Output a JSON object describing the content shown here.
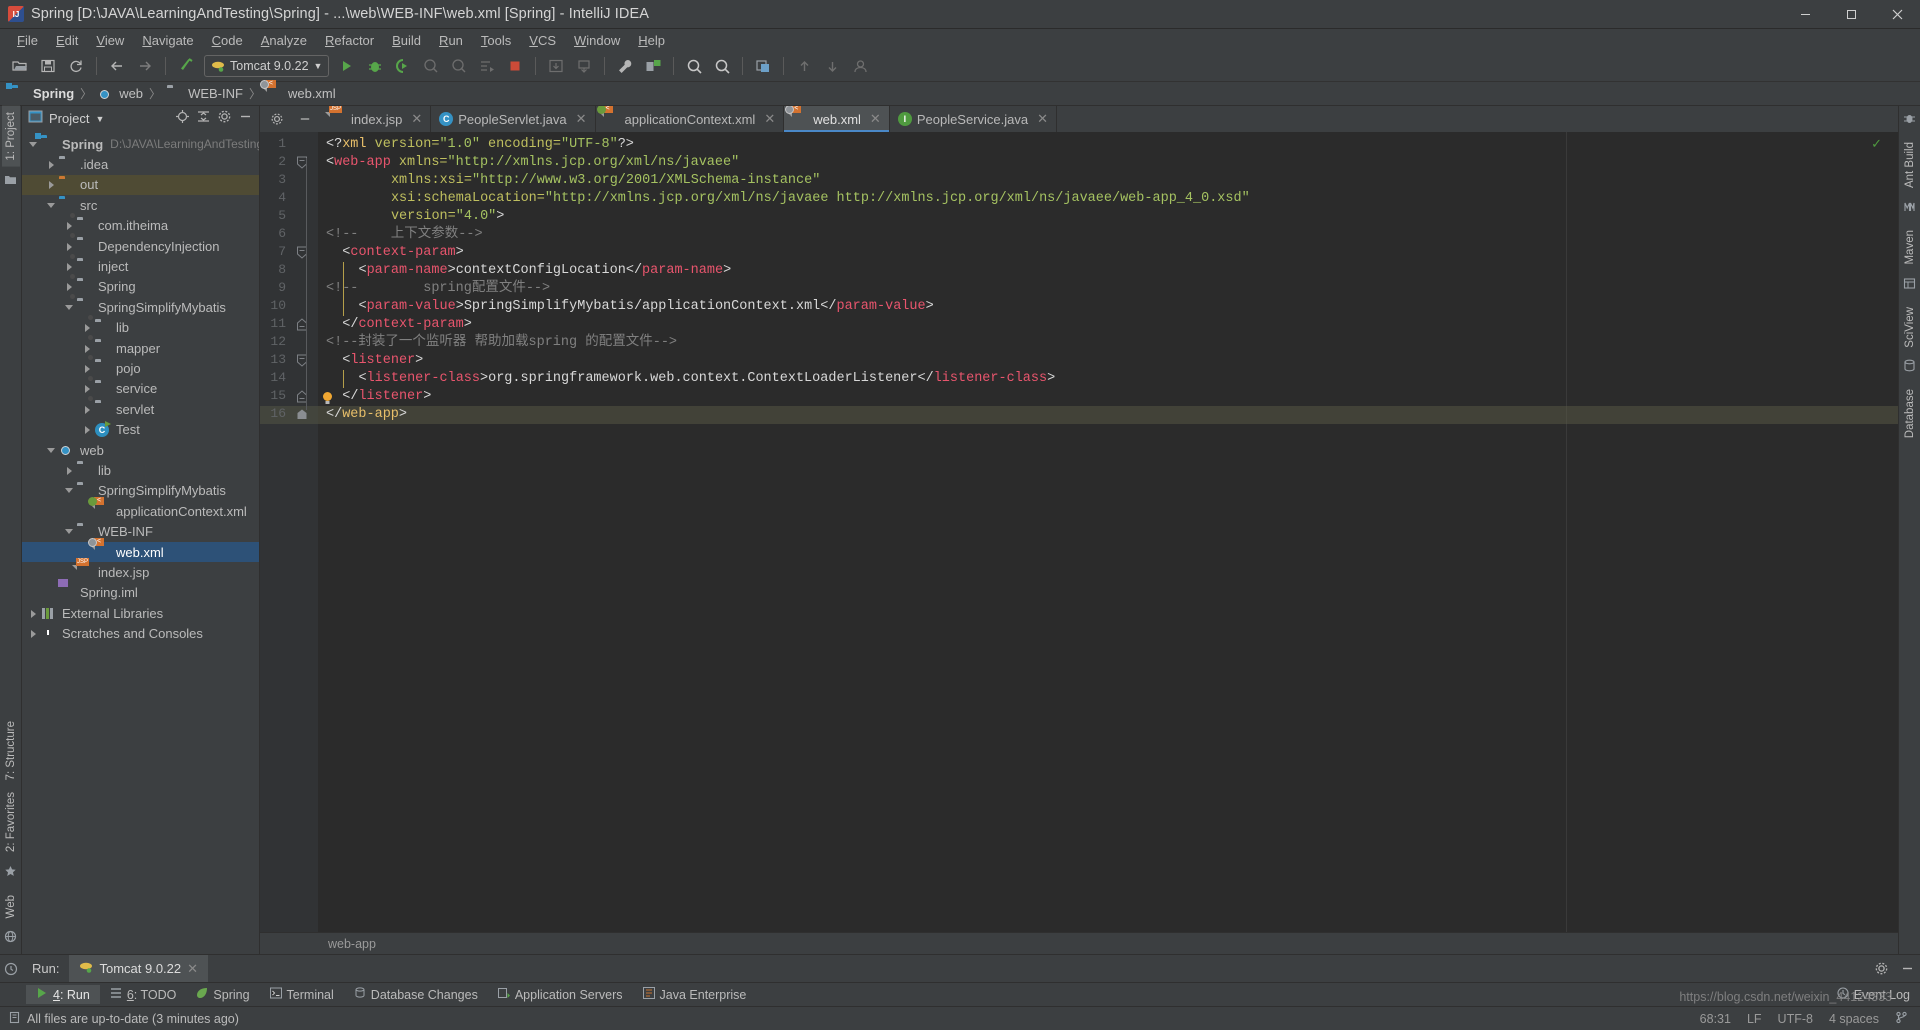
{
  "window": {
    "title": "Spring [D:\\JAVA\\LearningAndTesting\\Spring] - ...\\web\\WEB-INF\\web.xml [Spring] - IntelliJ IDEA",
    "app_icon": "intellij-idea-icon",
    "minimize": "–",
    "maximize": "□",
    "close": "✕"
  },
  "menubar": {
    "items": [
      {
        "label": "File"
      },
      {
        "label": "Edit"
      },
      {
        "label": "View"
      },
      {
        "label": "Navigate"
      },
      {
        "label": "Code"
      },
      {
        "label": "Analyze"
      },
      {
        "label": "Refactor"
      },
      {
        "label": "Build"
      },
      {
        "label": "Run"
      },
      {
        "label": "Tools"
      },
      {
        "label": "VCS"
      },
      {
        "label": "Window"
      },
      {
        "label": "Help"
      }
    ]
  },
  "toolbar": {
    "run_config": "Tomcat 9.0.22",
    "icons": [
      "open-folder-icon",
      "save-all-icon",
      "sync-refresh-icon",
      "back-arrow-icon",
      "forward-arrow-icon",
      "build-hammer-icon",
      "run-icon",
      "debug-icon",
      "run-with-coverage-icon",
      "profile-icon",
      "rerun-icon",
      "update-app-icon",
      "stop-icon",
      "settings-wrench-icon",
      "project-structure-icon",
      "search-everywhere-icon",
      "find-icon",
      "git-commit-icon",
      "git-update-icon",
      "git-push-icon",
      "user-icon"
    ]
  },
  "breadcrumb": {
    "items": [
      {
        "label": "Spring",
        "icon": "module-folder-icon"
      },
      {
        "label": "web",
        "icon": "web-module-icon"
      },
      {
        "label": "WEB-INF",
        "icon": "folder-icon"
      },
      {
        "label": "web.xml",
        "icon": "xml-file-icon"
      }
    ],
    "separator": "〉"
  },
  "left_strip": {
    "project_tab": "1: Project",
    "structure_tab": "7: Structure",
    "favorites_tab": "2: Favorites",
    "web_tab": "Web"
  },
  "right_strip": {
    "ant_build": "Ant Build",
    "maven": "Maven",
    "sciview": "SciView",
    "database": "Database"
  },
  "project_panel": {
    "title": "Project",
    "dropdown_icon": "chevron-down-icon",
    "locate_icon": "target-locate-icon",
    "collapse_icon": "collapse-all-icon",
    "settings_icon": "gear-icon",
    "hide_icon": "hide-icon",
    "tree": [
      {
        "label": "Spring",
        "path": "D:\\JAVA\\LearningAndTesting",
        "depth": 0,
        "state": "open",
        "icon": "module-folder-icon",
        "bold": true,
        "selected": false,
        "highlight": false
      },
      {
        "label": ".idea",
        "path": "",
        "depth": 1,
        "state": "closed",
        "icon": "folder-icon",
        "bold": false,
        "selected": false,
        "highlight": false
      },
      {
        "label": "out",
        "path": "",
        "depth": 1,
        "state": "closed",
        "icon": "folder-orange-icon",
        "bold": false,
        "selected": false,
        "highlight": true
      },
      {
        "label": "src",
        "path": "",
        "depth": 1,
        "state": "open",
        "icon": "source-folder-icon",
        "bold": false,
        "selected": false,
        "highlight": false
      },
      {
        "label": "com.itheima",
        "path": "",
        "depth": 2,
        "state": "closed",
        "icon": "package-icon",
        "bold": false,
        "selected": false,
        "highlight": false
      },
      {
        "label": "DependencyInjection",
        "path": "",
        "depth": 2,
        "state": "closed",
        "icon": "package-icon",
        "bold": false,
        "selected": false,
        "highlight": false
      },
      {
        "label": "inject",
        "path": "",
        "depth": 2,
        "state": "closed",
        "icon": "package-icon",
        "bold": false,
        "selected": false,
        "highlight": false
      },
      {
        "label": "Spring",
        "path": "",
        "depth": 2,
        "state": "closed",
        "icon": "package-icon",
        "bold": false,
        "selected": false,
        "highlight": false
      },
      {
        "label": "SpringSimplifyMybatis",
        "path": "",
        "depth": 2,
        "state": "open",
        "icon": "package-icon",
        "bold": false,
        "selected": false,
        "highlight": false
      },
      {
        "label": "lib",
        "path": "",
        "depth": 3,
        "state": "closed",
        "icon": "package-icon",
        "bold": false,
        "selected": false,
        "highlight": false
      },
      {
        "label": "mapper",
        "path": "",
        "depth": 3,
        "state": "closed",
        "icon": "package-icon",
        "bold": false,
        "selected": false,
        "highlight": false
      },
      {
        "label": "pojo",
        "path": "",
        "depth": 3,
        "state": "closed",
        "icon": "package-icon",
        "bold": false,
        "selected": false,
        "highlight": false
      },
      {
        "label": "service",
        "path": "",
        "depth": 3,
        "state": "closed",
        "icon": "package-icon",
        "bold": false,
        "selected": false,
        "highlight": false
      },
      {
        "label": "servlet",
        "path": "",
        "depth": 3,
        "state": "closed",
        "icon": "package-icon",
        "bold": false,
        "selected": false,
        "highlight": false
      },
      {
        "label": "Test",
        "path": "",
        "depth": 3,
        "state": "closed",
        "icon": "java-test-class-icon",
        "bold": false,
        "selected": false,
        "highlight": false
      },
      {
        "label": "web",
        "path": "",
        "depth": 1,
        "state": "open",
        "icon": "web-module-icon",
        "bold": false,
        "selected": false,
        "highlight": false
      },
      {
        "label": "lib",
        "path": "",
        "depth": 2,
        "state": "closed",
        "icon": "folder-icon",
        "bold": false,
        "selected": false,
        "highlight": false
      },
      {
        "label": "SpringSimplifyMybatis",
        "path": "",
        "depth": 2,
        "state": "open",
        "icon": "folder-icon",
        "bold": false,
        "selected": false,
        "highlight": false
      },
      {
        "label": "applicationContext.xml",
        "path": "",
        "depth": 3,
        "state": "leaf",
        "icon": "spring-xml-file-icon",
        "bold": false,
        "selected": false,
        "highlight": false
      },
      {
        "label": "WEB-INF",
        "path": "",
        "depth": 2,
        "state": "open",
        "icon": "folder-icon",
        "bold": false,
        "selected": false,
        "highlight": false
      },
      {
        "label": "web.xml",
        "path": "",
        "depth": 3,
        "state": "leaf",
        "icon": "xml-file-icon",
        "bold": false,
        "selected": true,
        "highlight": false
      },
      {
        "label": "index.jsp",
        "path": "",
        "depth": 2,
        "state": "leaf",
        "icon": "jsp-file-icon",
        "bold": false,
        "selected": false,
        "highlight": false
      },
      {
        "label": "Spring.iml",
        "path": "",
        "depth": 1,
        "state": "leaf",
        "icon": "iml-file-icon",
        "bold": false,
        "selected": false,
        "highlight": false
      },
      {
        "label": "External Libraries",
        "path": "",
        "depth": 0,
        "state": "closed",
        "icon": "libraries-icon",
        "bold": false,
        "selected": false,
        "highlight": false
      },
      {
        "label": "Scratches and Consoles",
        "path": "",
        "depth": 0,
        "state": "closed",
        "icon": "scratches-icon",
        "bold": false,
        "selected": false,
        "highlight": false
      }
    ]
  },
  "editor": {
    "tabs": [
      {
        "label": "index.jsp",
        "icon": "jsp-file-icon",
        "active": false
      },
      {
        "label": "PeopleServlet.java",
        "icon": "java-class-icon",
        "active": false
      },
      {
        "label": "applicationContext.xml",
        "icon": "spring-xml-file-icon",
        "active": false
      },
      {
        "label": "web.xml",
        "icon": "xml-file-icon",
        "active": true
      },
      {
        "label": "PeopleService.java",
        "icon": "java-interface-icon",
        "active": false
      }
    ],
    "close_icon": "✕",
    "gear_icon": "gear-icon",
    "minimize_icon": "minimize-icon",
    "current_line": 16,
    "inspection_ok_icon": "✓",
    "breadcrumb_footer": "web-app",
    "lines": [
      {
        "n": 1,
        "indent": 0,
        "fold": "",
        "tokens": [
          {
            "t": "<?",
            "c": "k-brk"
          },
          {
            "t": "xml",
            "c": "k-pi"
          },
          {
            "t": " version=",
            "c": "k-attr"
          },
          {
            "t": "\"1.0\"",
            "c": "k-str"
          },
          {
            "t": " encoding=",
            "c": "k-attr"
          },
          {
            "t": "\"UTF-8\"",
            "c": "k-str"
          },
          {
            "t": "?>",
            "c": "k-brk"
          }
        ]
      },
      {
        "n": 2,
        "indent": 0,
        "fold": "open",
        "tokens": [
          {
            "t": "<",
            "c": "k-brk"
          },
          {
            "t": "web-app",
            "c": "k-tag"
          },
          {
            "t": " xmlns=",
            "c": "k-attr"
          },
          {
            "t": "\"http://xmlns.jcp.org/xml/ns/javaee\"",
            "c": "k-str"
          }
        ]
      },
      {
        "n": 3,
        "indent": 8,
        "fold": "",
        "tokens": [
          {
            "t": "xmlns:",
            "c": "k-attr"
          },
          {
            "t": "xsi",
            "c": "k-attr"
          },
          {
            "t": "=",
            "c": "k-attr"
          },
          {
            "t": "\"http://www.w3.org/2001/XMLSchema-instance\"",
            "c": "k-str"
          }
        ]
      },
      {
        "n": 4,
        "indent": 8,
        "fold": "",
        "tokens": [
          {
            "t": "xsi:schemaLocation=",
            "c": "k-attr"
          },
          {
            "t": "\"http://xmlns.jcp.org/xml/ns/javaee http://xmlns.jcp.org/xml/ns/javaee/web-app_4_0.xsd\"",
            "c": "k-str"
          }
        ]
      },
      {
        "n": 5,
        "indent": 8,
        "fold": "",
        "tokens": [
          {
            "t": "version=",
            "c": "k-attr"
          },
          {
            "t": "\"4.0\"",
            "c": "k-str"
          },
          {
            "t": ">",
            "c": "k-brk"
          }
        ]
      },
      {
        "n": 6,
        "indent": -3,
        "fold": "",
        "tokens": [
          {
            "t": "<!--    上下文参数-->",
            "c": "k-cmt"
          }
        ]
      },
      {
        "n": 7,
        "indent": 2,
        "fold": "open",
        "tokens": [
          {
            "t": "<",
            "c": "k-brk"
          },
          {
            "t": "context-param",
            "c": "k-tag"
          },
          {
            "t": ">",
            "c": "k-brk"
          }
        ]
      },
      {
        "n": 8,
        "indent": 4,
        "fold": "",
        "tokens": [
          {
            "t": "<",
            "c": "k-brk"
          },
          {
            "t": "param-name",
            "c": "k-tag"
          },
          {
            "t": ">",
            "c": "k-brk"
          },
          {
            "t": "contextConfigLocation",
            "c": "k-txt"
          },
          {
            "t": "</",
            "c": "k-brk"
          },
          {
            "t": "param-name",
            "c": "k-tag"
          },
          {
            "t": ">",
            "c": "k-brk"
          }
        ]
      },
      {
        "n": 9,
        "indent": -3,
        "fold": "",
        "tokens": [
          {
            "t": "<!--        spring配置文件-->",
            "c": "k-cmt"
          }
        ]
      },
      {
        "n": 10,
        "indent": 4,
        "fold": "",
        "tokens": [
          {
            "t": "<",
            "c": "k-brk"
          },
          {
            "t": "param-value",
            "c": "k-tag"
          },
          {
            "t": ">",
            "c": "k-brk"
          },
          {
            "t": "SpringSimplifyMybatis/applicationContext.xml",
            "c": "k-txt"
          },
          {
            "t": "</",
            "c": "k-brk"
          },
          {
            "t": "param-value",
            "c": "k-tag"
          },
          {
            "t": ">",
            "c": "k-brk"
          }
        ]
      },
      {
        "n": 11,
        "indent": 2,
        "fold": "close",
        "tokens": [
          {
            "t": "</",
            "c": "k-brk"
          },
          {
            "t": "context-param",
            "c": "k-tag"
          },
          {
            "t": ">",
            "c": "k-brk"
          }
        ]
      },
      {
        "n": 12,
        "indent": -3,
        "fold": "",
        "tokens": [
          {
            "t": "<!--封装了一个监听器 帮助加载spring 的配置文件-->",
            "c": "k-cmt"
          }
        ]
      },
      {
        "n": 13,
        "indent": 2,
        "fold": "open",
        "tokens": [
          {
            "t": "<",
            "c": "k-brk"
          },
          {
            "t": "listener",
            "c": "k-tag"
          },
          {
            "t": ">",
            "c": "k-brk"
          }
        ]
      },
      {
        "n": 14,
        "indent": 4,
        "fold": "",
        "tokens": [
          {
            "t": "<",
            "c": "k-brk"
          },
          {
            "t": "listener-class",
            "c": "k-tag"
          },
          {
            "t": ">",
            "c": "k-brk"
          },
          {
            "t": "org.springframework.web.context.ContextLoaderListener",
            "c": "k-txt"
          },
          {
            "t": "</",
            "c": "k-brk"
          },
          {
            "t": "listener-class",
            "c": "k-tag"
          },
          {
            "t": ">",
            "c": "k-brk"
          }
        ]
      },
      {
        "n": 15,
        "indent": 2,
        "fold": "close",
        "tokens": [
          {
            "t": "</",
            "c": "k-brk"
          },
          {
            "t": "listener",
            "c": "k-tag"
          },
          {
            "t": ">",
            "c": "k-brk"
          }
        ]
      },
      {
        "n": 16,
        "indent": 0,
        "fold": "end",
        "tokens": [
          {
            "t": "</",
            "c": "k-brk"
          },
          {
            "t": "web-app",
            "c": "k-web"
          },
          {
            "t": ">",
            "c": "k-brk"
          }
        ]
      }
    ]
  },
  "run_window": {
    "label": "Run:",
    "tab": "Tomcat 9.0.22",
    "tab_icon": "tomcat-icon",
    "close_icon": "✕",
    "settings_icon": "gear-icon",
    "minimize_icon": "–"
  },
  "bottom_bar": {
    "items": [
      {
        "label": "4: Run",
        "icon": "run-icon",
        "selected": true
      },
      {
        "label": "6: TODO",
        "icon": "todo-icon",
        "selected": false
      },
      {
        "label": "Spring",
        "icon": "spring-leaf-icon",
        "selected": false
      },
      {
        "label": "Terminal",
        "icon": "terminal-icon",
        "selected": false
      },
      {
        "label": "Database Changes",
        "icon": "database-changes-icon",
        "selected": false
      },
      {
        "label": "Application Servers",
        "icon": "application-servers-icon",
        "selected": false
      },
      {
        "label": "Java Enterprise",
        "icon": "java-enterprise-icon",
        "selected": false
      }
    ],
    "event_log": "Event Log",
    "event_log_icon": "event-log-icon"
  },
  "status_bar": {
    "message": "All files are up-to-date (3 minutes ago)",
    "message_icon": "file-sync-icon",
    "position": "68:31",
    "line_separator": "LF",
    "encoding": "UTF-8",
    "indent": "4 spaces",
    "branch_icon": "git-branch-icon"
  },
  "watermark": "https://blog.csdn.net/weixin_44124333",
  "colors": {
    "background": "#3c3f41",
    "editor_bg": "#2b2b2b",
    "gutter_bg": "#313335",
    "selection": "#2d5177",
    "accent": "#4a88c7",
    "tag": "#e8556d",
    "string": "#a5c261",
    "attr": "#bfbf5f",
    "comment": "#808080"
  }
}
